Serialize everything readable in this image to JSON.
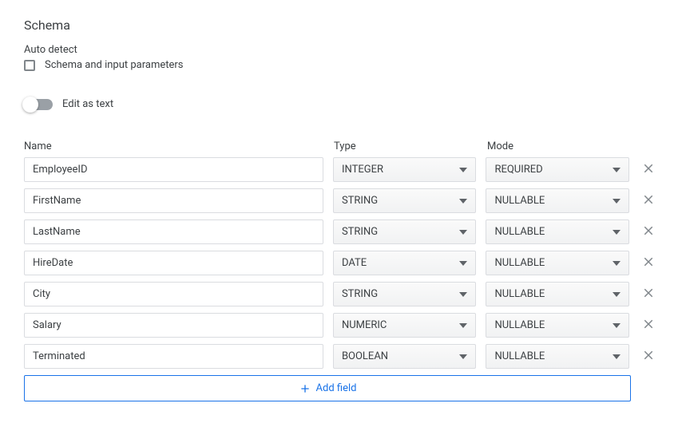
{
  "heading": "Schema",
  "auto_detect_label": "Auto detect",
  "auto_detect_checkbox_label": "Schema and input parameters",
  "edit_as_text_label": "Edit as text",
  "columns": {
    "name": "Name",
    "type": "Type",
    "mode": "Mode"
  },
  "fields": [
    {
      "name": "EmployeeID",
      "type": "INTEGER",
      "mode": "REQUIRED"
    },
    {
      "name": "FirstName",
      "type": "STRING",
      "mode": "NULLABLE"
    },
    {
      "name": "LastName",
      "type": "STRING",
      "mode": "NULLABLE"
    },
    {
      "name": "HireDate",
      "type": "DATE",
      "mode": "NULLABLE"
    },
    {
      "name": "City",
      "type": "STRING",
      "mode": "NULLABLE"
    },
    {
      "name": "Salary",
      "type": "NUMERIC",
      "mode": "NULLABLE"
    },
    {
      "name": "Terminated",
      "type": "BOOLEAN",
      "mode": "NULLABLE"
    }
  ],
  "add_field_label": "Add field"
}
